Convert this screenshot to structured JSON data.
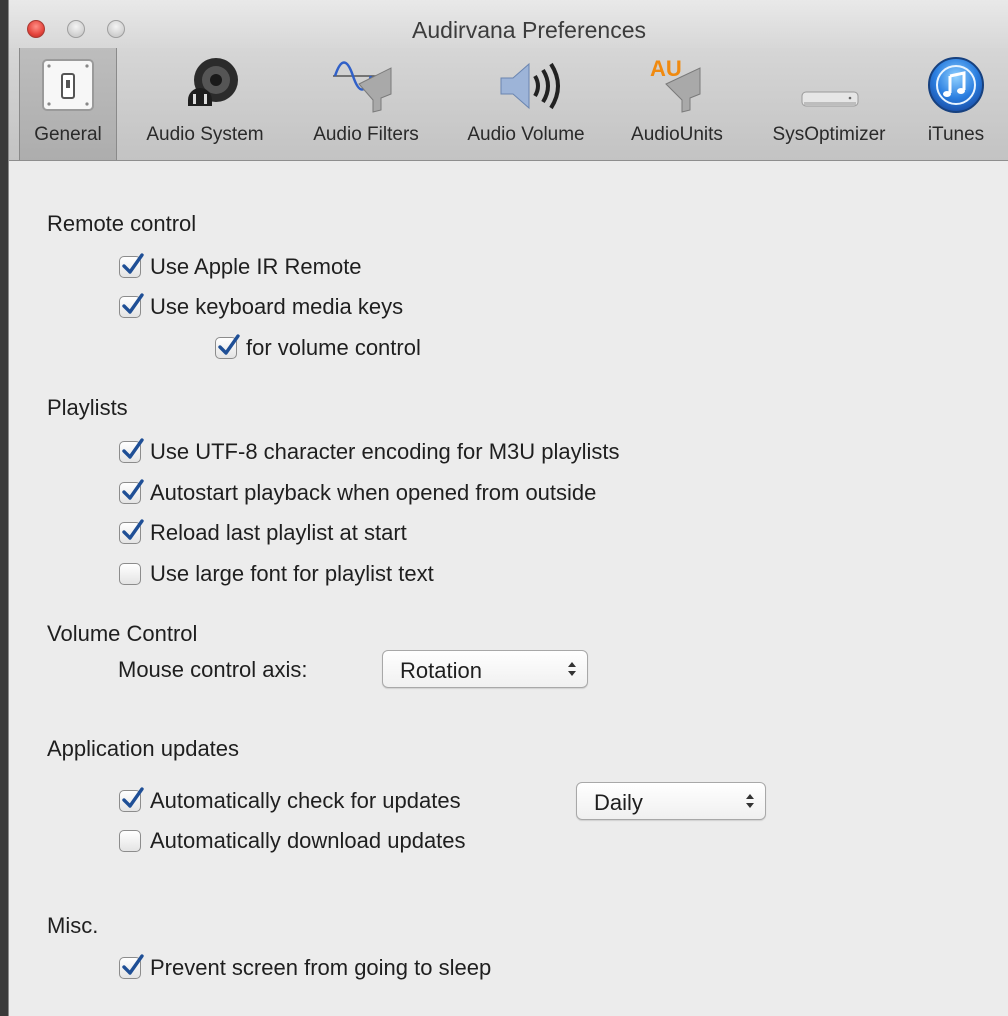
{
  "window": {
    "title": "Audirvana Preferences"
  },
  "toolbar": {
    "items": [
      {
        "label": "General",
        "icon": "general-switch-icon"
      },
      {
        "label": "Audio System",
        "icon": "speaker-plug-icon"
      },
      {
        "label": "Audio Filters",
        "icon": "sine-wave-funnel-icon"
      },
      {
        "label": "Audio Volume",
        "icon": "volume-speaker-icon"
      },
      {
        "label": "AudioUnits",
        "icon": "au-funnel-icon"
      },
      {
        "label": "SysOptimizer",
        "icon": "mac-mini-icon"
      },
      {
        "label": "iTunes",
        "icon": "itunes-icon"
      }
    ],
    "au_badge": "AU",
    "selected": "General"
  },
  "remote": {
    "title": "Remote control",
    "apple_ir": {
      "label": "Use Apple IR Remote",
      "checked": true
    },
    "media_keys": {
      "label": "Use keyboard media keys",
      "checked": true
    },
    "volume": {
      "label": "for volume control",
      "checked": true
    }
  },
  "playlists": {
    "title": "Playlists",
    "utf8": {
      "label": "Use UTF-8 character encoding for M3U playlists",
      "checked": true
    },
    "autostart": {
      "label": "Autostart playback when opened from outside",
      "checked": true
    },
    "reload": {
      "label": "Reload last playlist at start",
      "checked": true
    },
    "large_font": {
      "label": "Use large font for playlist text",
      "checked": false
    }
  },
  "volume_control": {
    "title": "Volume Control",
    "axis_label": "Mouse control axis:",
    "axis_value": "Rotation"
  },
  "updates": {
    "title": "Application updates",
    "auto_check": {
      "label": "Automatically check for updates",
      "checked": true
    },
    "frequency": "Daily",
    "auto_download": {
      "label": "Automatically download updates",
      "checked": false
    }
  },
  "misc": {
    "title": "Misc.",
    "prevent_sleep": {
      "label": "Prevent screen from going to sleep",
      "checked": true
    }
  },
  "colors": {
    "check": "#1f4f96",
    "toolbar": "#c8c8c8",
    "background": "#ececec"
  }
}
